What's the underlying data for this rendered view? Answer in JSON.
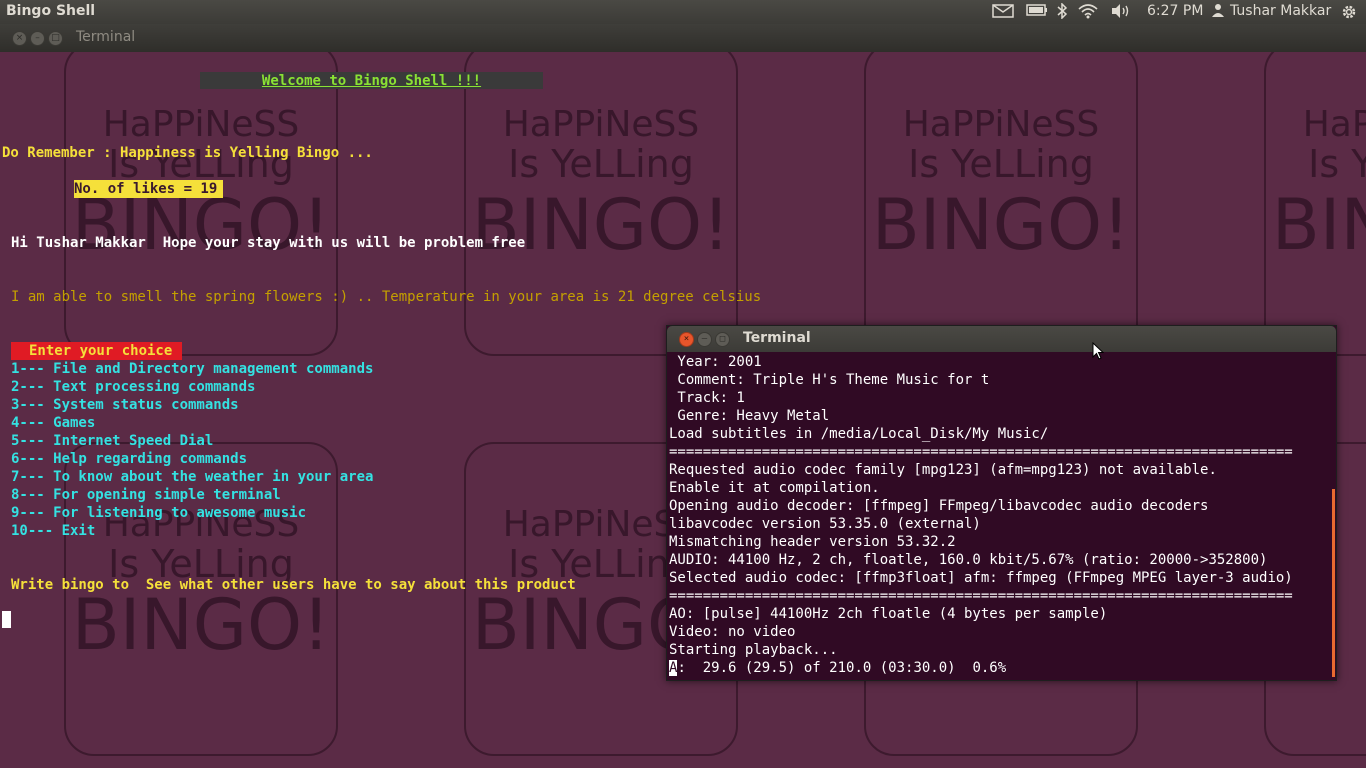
{
  "panel": {
    "app_name": "Bingo Shell",
    "time": "6:27 PM",
    "user": "Tushar Makkar"
  },
  "main_window": {
    "title": "Terminal"
  },
  "wallpaper": {
    "text_line1": "HaPPiNeSS",
    "text_line2": "Is YeLLing",
    "text_line3": "BINGO!"
  },
  "shell": {
    "welcome": "Welcome to Bingo Shell !!!",
    "remember": "Do Remember : Happiness is Yelling Bingo ...",
    "likes": "No. of likes = 19",
    "greeting": "Hi Tushar Makkar  Hope your stay with us will be problem free",
    "weather": "I am able to smell the spring flowers :) .. Temperature in your area is 21 degree celsius",
    "choice_prompt": "Enter your choice",
    "menu": [
      "1--- File and Directory management commands",
      "2--- Text processing commands",
      "3--- System status commands",
      "4--- Games",
      "5--- Internet Speed Dial",
      "6--- Help regarding commands",
      "7--- To know about the weather in your area",
      "8--- For opening simple terminal",
      "9--- For listening to awesome music",
      "10--- Exit"
    ],
    "footer": "Write bingo to  See what other users have to say about this product"
  },
  "music_terminal": {
    "title": "Terminal",
    "lines": [
      " Year: 2001",
      " Comment: Triple H's Theme Music for t",
      " Track: 1",
      " Genre: Heavy Metal",
      "Load subtitles in /media/Local_Disk/My Music/",
      "==========================================================================",
      "Requested audio codec family [mpg123] (afm=mpg123) not available.",
      "Enable it at compilation.",
      "Opening audio decoder: [ffmpeg] FFmpeg/libavcodec audio decoders",
      "libavcodec version 53.35.0 (external)",
      "Mismatching header version 53.32.2",
      "AUDIO: 44100 Hz, 2 ch, floatle, 160.0 kbit/5.67% (ratio: 20000->352800)",
      "Selected audio codec: [ffmp3float] afm: ffmpeg (FFmpeg MPEG layer-3 audio)",
      "==========================================================================",
      "AO: [pulse] 44100Hz 2ch floatle (4 bytes per sample)",
      "Video: no video",
      "Starting playback...",
      ":  29.6 (29.5) of 210.0 (03:30.0)  0.6%"
    ],
    "cursor_char": "A"
  },
  "colors": {
    "yellow": "#f5e03a",
    "cyan": "#34e2e2",
    "white": "#ffffff",
    "orange": "#c4a000",
    "red_bg": "#e01b24",
    "green": "#8ae234"
  }
}
